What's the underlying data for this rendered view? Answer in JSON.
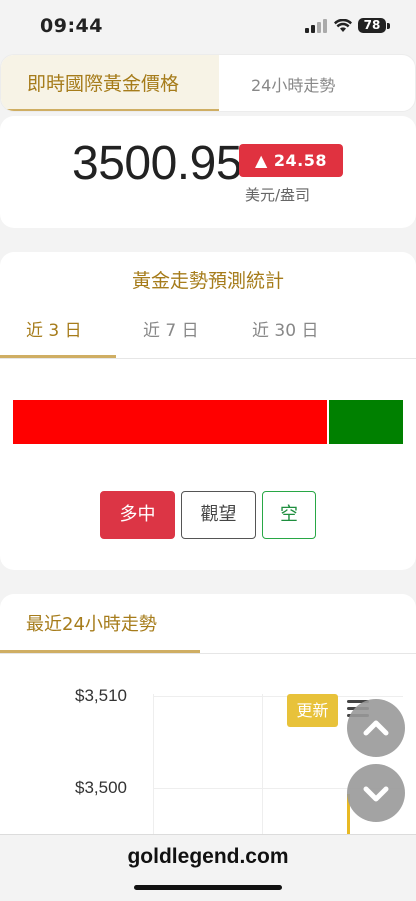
{
  "status_bar": {
    "time": "09:44",
    "battery": "78"
  },
  "top_tabs": {
    "active": "即時國際黃金價格",
    "inactive": "24小時走勢"
  },
  "price": {
    "value": "3500.95",
    "change": "▲ 24.58",
    "unit": "美元/盎司"
  },
  "forecast": {
    "title": "黃金走勢預測統計",
    "tabs": [
      "近 3 日",
      "近 7 日",
      "近 30 日"
    ],
    "bar": {
      "bullish_fraction": 0.81,
      "bearish_fraction": 0.19,
      "bullish_color": "#ff0000",
      "bearish_color": "#008000"
    },
    "buttons": {
      "buy": "多中",
      "wait": "觀望",
      "short": "空"
    }
  },
  "chart": {
    "title": "最近24小時走勢",
    "update_label": "更新",
    "y_ticks": [
      "$3,510",
      "$3,500"
    ]
  },
  "browser": {
    "url": "goldlegend.com"
  }
}
